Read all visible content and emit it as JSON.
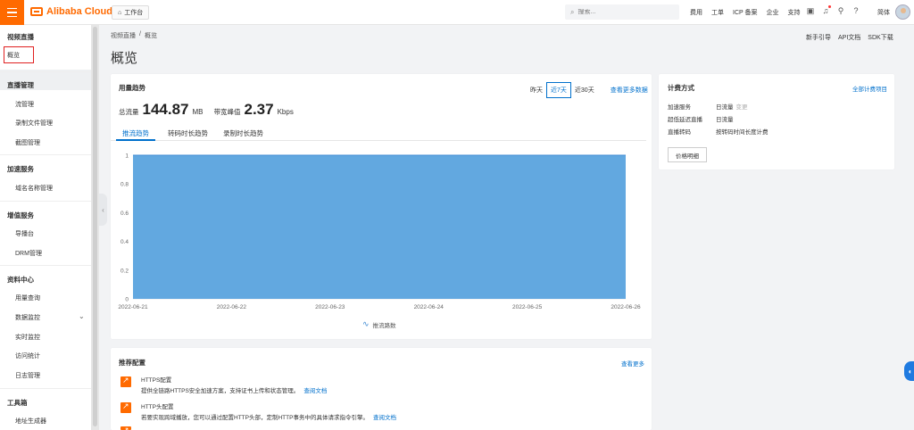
{
  "topbar": {
    "brand": "Alibaba Cloud",
    "workspace": "工作台",
    "search_placeholder": "搜索...",
    "links": [
      "费用",
      "工单",
      "ICP 备案",
      "企业",
      "支持"
    ],
    "lang": "简体"
  },
  "sidebar": {
    "product": "视频直播",
    "overview": "概览",
    "groups": [
      {
        "title": "直播管理",
        "items": [
          "流管理",
          "录制文件管理",
          "截图管理"
        ]
      },
      {
        "title": "加速服务",
        "items": [
          "域名名称管理"
        ]
      },
      {
        "title": "增值服务",
        "items": [
          "导播台",
          "DRM管理"
        ]
      },
      {
        "title": "资料中心",
        "items": [
          "用量查询",
          "数据监控",
          "实时监控",
          "访问统计",
          "日志管理"
        ]
      },
      {
        "title": "工具箱",
        "items": [
          "地址生成器"
        ]
      }
    ]
  },
  "breadcrumb": {
    "root": "视频直播",
    "sep": "/",
    "current": "概览"
  },
  "page_title": "概览",
  "help_links": [
    "新手引导",
    "API文档",
    "SDK下载"
  ],
  "usage": {
    "title": "用量趋势",
    "ranges": [
      "昨天",
      "近7天",
      "近30天"
    ],
    "selected_range": "近7天",
    "more": "查看更多数据",
    "total_label": "总流量",
    "total_value": "144.87",
    "total_unit": "MB",
    "peak_label": "带宽峰值",
    "peak_value": "2.37",
    "peak_unit": "Kbps",
    "tabs": [
      "推流趋势",
      "转码时长趋势",
      "录制时长趋势"
    ],
    "legend": "推流路数"
  },
  "chart_data": {
    "type": "area",
    "x": [
      "2022-06-21",
      "2022-06-22",
      "2022-06-23",
      "2022-06-24",
      "2022-06-25",
      "2022-06-26"
    ],
    "series": [
      {
        "name": "推流路数",
        "values": [
          1,
          1,
          1,
          1,
          1,
          1
        ]
      }
    ],
    "y_ticks": [
      "0",
      "0.2",
      "0.4",
      "0.6",
      "0.8",
      "1"
    ],
    "ylim": [
      0,
      1
    ],
    "color": "#62a8e0",
    "line_color": "#3d8ad3"
  },
  "billing": {
    "title": "计费方式",
    "all_link": "全部计费项目",
    "rows": [
      {
        "label": "加速服务",
        "value": "日流量",
        "extra": "变更"
      },
      {
        "label": "超低延迟直播",
        "value": "日流量",
        "extra": ""
      },
      {
        "label": "直播转码",
        "value": "按转码时间长度计费",
        "extra": ""
      }
    ],
    "price_button": "价格明细"
  },
  "recommend": {
    "title": "推荐配置",
    "more": "查看更多",
    "items": [
      {
        "title": "HTTPS配置",
        "desc": "提供全链路HTTPS安全加速方案，支持证书上传和状态管理。",
        "link": "查阅文档"
      },
      {
        "title": "HTTP头配置",
        "desc": "若要实现跨域播放，您可以通过配置HTTP头部，定制HTTP事务中的具体请求指令引擎。",
        "link": "查阅文档"
      }
    ]
  }
}
